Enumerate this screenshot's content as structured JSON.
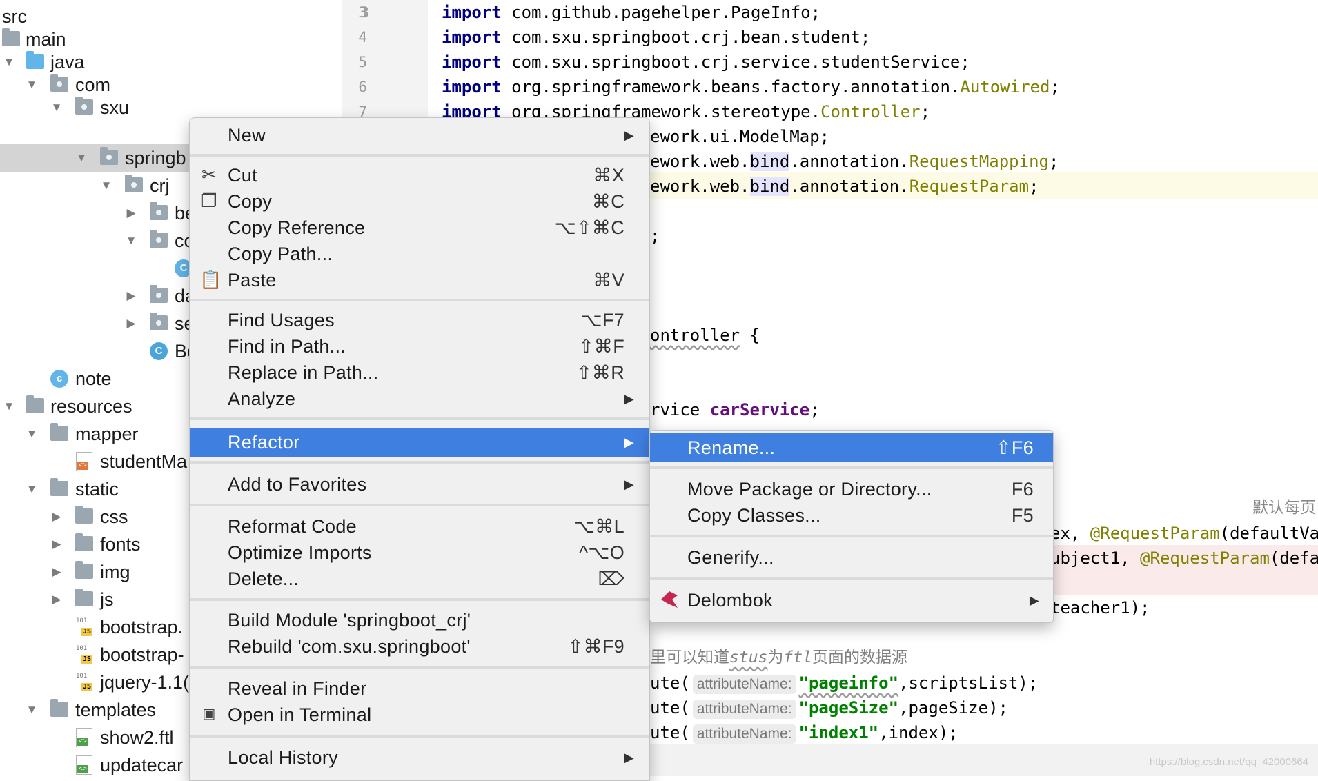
{
  "tree": {
    "rows": [
      {
        "label": "src",
        "icon": "none"
      },
      {
        "label": "main",
        "icon": "folder"
      },
      {
        "label": "java",
        "icon": "folder-blue"
      },
      {
        "label": "com",
        "icon": "package"
      },
      {
        "label": "sxu",
        "icon": "package"
      },
      {
        "label": "springb",
        "icon": "package"
      },
      {
        "label": "crj",
        "icon": "package"
      },
      {
        "label": "be",
        "icon": "package"
      },
      {
        "label": "co",
        "icon": "package"
      },
      {
        "label": "C",
        "icon": "class"
      },
      {
        "label": "da",
        "icon": "package"
      },
      {
        "label": "se",
        "icon": "package"
      },
      {
        "label": "Bo",
        "icon": "class"
      },
      {
        "label": "note",
        "icon": "class"
      },
      {
        "label": "resources",
        "icon": "folder"
      },
      {
        "label": "mapper",
        "icon": "folder"
      },
      {
        "label": "studentMa",
        "icon": "file-html"
      },
      {
        "label": "static",
        "icon": "folder"
      },
      {
        "label": "css",
        "icon": "folder"
      },
      {
        "label": "fonts",
        "icon": "folder"
      },
      {
        "label": "img",
        "icon": "folder"
      },
      {
        "label": "js",
        "icon": "folder"
      },
      {
        "label": "bootstrap.",
        "icon": "file-js"
      },
      {
        "label": "bootstrap-",
        "icon": "file-js"
      },
      {
        "label": "jquery-1.1(",
        "icon": "file-js"
      },
      {
        "label": "templates",
        "icon": "folder"
      },
      {
        "label": "show2.ftl",
        "icon": "file-ftl"
      },
      {
        "label": "updatecar",
        "icon": "file-ftl"
      }
    ]
  },
  "editor": {
    "line_numbers": [
      "3",
      "4",
      "5",
      "6",
      "7"
    ],
    "imports": [
      {
        "kw": "import",
        "pkg": "com.github.pagehelper.PageInfo;",
        "ann": ""
      },
      {
        "kw": "import",
        "pkg": "com.sxu.springboot.crj.bean.student;",
        "ann": ""
      },
      {
        "kw": "import",
        "pkg": "com.sxu.springboot.crj.service.studentService;",
        "ann": ""
      },
      {
        "kw": "import",
        "pkg": "org.springframework.beans.factory.annotation.",
        "ann": "Autowired",
        "tail": ";"
      },
      {
        "kw": "import",
        "pkg": "org.springframework.stereotype.",
        "ann": "Controller",
        "tail": ";"
      }
    ],
    "visible_fragments": {
      "modelmap": "ework.ui.ModelMap;",
      "reqmap_a": "ework.web.",
      "reqmap_bind": "bind",
      "reqmap_b": ".annotation.",
      "reqmap_ann": "RequestMapping",
      "reqparam_a": "ework.web.",
      "reqparam_bind": "bind",
      "reqparam_b": ".annotation.",
      "reqparam_ann": "RequestParam",
      "semicolon": ";",
      "semi_tail": ";",
      "controller_frag": "ontroller",
      "controller_tail": " {",
      "service_a": "rvice ",
      "service_field": "carService",
      "service_tail": ";",
      "cn_default": "默认每页",
      "param_line1_a": "ex, ",
      "param_line1_ann": "@RequestParam",
      "param_line1_b": "(defaultVal",
      "param_line2_a": "ubject1, ",
      "param_line2_ann": "@RequestParam",
      "param_line2_b": "(defau",
      "teacher_line": "teacher1);",
      "comment_a": "里可以知道",
      "comment_stus": "stus",
      "comment_b": "为",
      "comment_ftl": "ftl",
      "comment_c": "页面的数据源",
      "attr1_a": "ute(",
      "attr1_hint": "attributeName:",
      "attr1_str": "\"pageinfo\"",
      "attr1_tail": ",scriptsList);",
      "attr2_a": "ute(",
      "attr2_hint": "attributeName:",
      "attr2_str": "\"pageSize\"",
      "attr2_tail": ",pageSize);",
      "attr3_a": "ute(",
      "attr3_hint": "attributeName:",
      "attr3_str": "\"index1\"",
      "attr3_tail": ",index);"
    }
  },
  "context_menu": {
    "items": [
      {
        "label": "New",
        "shortcut": "",
        "submenu": true,
        "icon": ""
      },
      {
        "label": "Cut",
        "shortcut": "⌘X",
        "submenu": false,
        "icon": "scissors-icon"
      },
      {
        "label": "Copy",
        "shortcut": "⌘C",
        "submenu": false,
        "icon": "copy-icon"
      },
      {
        "label": "Copy Reference",
        "shortcut": "⌥⇧⌘C",
        "submenu": false,
        "icon": ""
      },
      {
        "label": "Copy Path...",
        "shortcut": "",
        "submenu": false,
        "icon": ""
      },
      {
        "label": "Paste",
        "shortcut": "⌘V",
        "submenu": false,
        "icon": "paste-icon"
      },
      {
        "label": "Find Usages",
        "shortcut": "⌥F7",
        "submenu": false,
        "icon": ""
      },
      {
        "label": "Find in Path...",
        "shortcut": "⇧⌘F",
        "submenu": false,
        "icon": ""
      },
      {
        "label": "Replace in Path...",
        "shortcut": "⇧⌘R",
        "submenu": false,
        "icon": ""
      },
      {
        "label": "Analyze",
        "shortcut": "",
        "submenu": true,
        "icon": ""
      },
      {
        "label": "Refactor",
        "shortcut": "",
        "submenu": true,
        "icon": "",
        "active": true
      },
      {
        "label": "Add to Favorites",
        "shortcut": "",
        "submenu": true,
        "icon": ""
      },
      {
        "label": "Reformat Code",
        "shortcut": "⌥⌘L",
        "submenu": false,
        "icon": ""
      },
      {
        "label": "Optimize Imports",
        "shortcut": "^⌥O",
        "submenu": false,
        "icon": ""
      },
      {
        "label": "Delete...",
        "shortcut": "⌦",
        "submenu": false,
        "icon": ""
      },
      {
        "label": "Build Module 'springboot_crj'",
        "shortcut": "",
        "submenu": false,
        "icon": ""
      },
      {
        "label": "Rebuild 'com.sxu.springboot'",
        "shortcut": "⇧⌘F9",
        "submenu": false,
        "icon": ""
      },
      {
        "label": "Reveal in Finder",
        "shortcut": "",
        "submenu": false,
        "icon": ""
      },
      {
        "label": "Open in Terminal",
        "shortcut": "",
        "submenu": false,
        "icon": "terminal-icon"
      },
      {
        "label": "Local History",
        "shortcut": "",
        "submenu": true,
        "icon": ""
      }
    ]
  },
  "refactor_submenu": {
    "items": [
      {
        "label": "Rename...",
        "shortcut": "⇧F6",
        "submenu": false,
        "active": true
      },
      {
        "label": "Move Package or Directory...",
        "shortcut": "F6",
        "submenu": false
      },
      {
        "label": "Copy Classes...",
        "shortcut": "F5",
        "submenu": false
      },
      {
        "label": "Generify...",
        "shortcut": "",
        "submenu": false
      },
      {
        "label": "Delombok",
        "shortcut": "",
        "submenu": true,
        "icon": "lombok-icon"
      }
    ]
  },
  "watermark": "https://blog.csdn.net/qq_42000664",
  "colors": {
    "menu_highlight": "#3f7fe0",
    "keyword": "#000080",
    "annotation": "#808000",
    "string": "#008000",
    "field": "#660e7a"
  }
}
